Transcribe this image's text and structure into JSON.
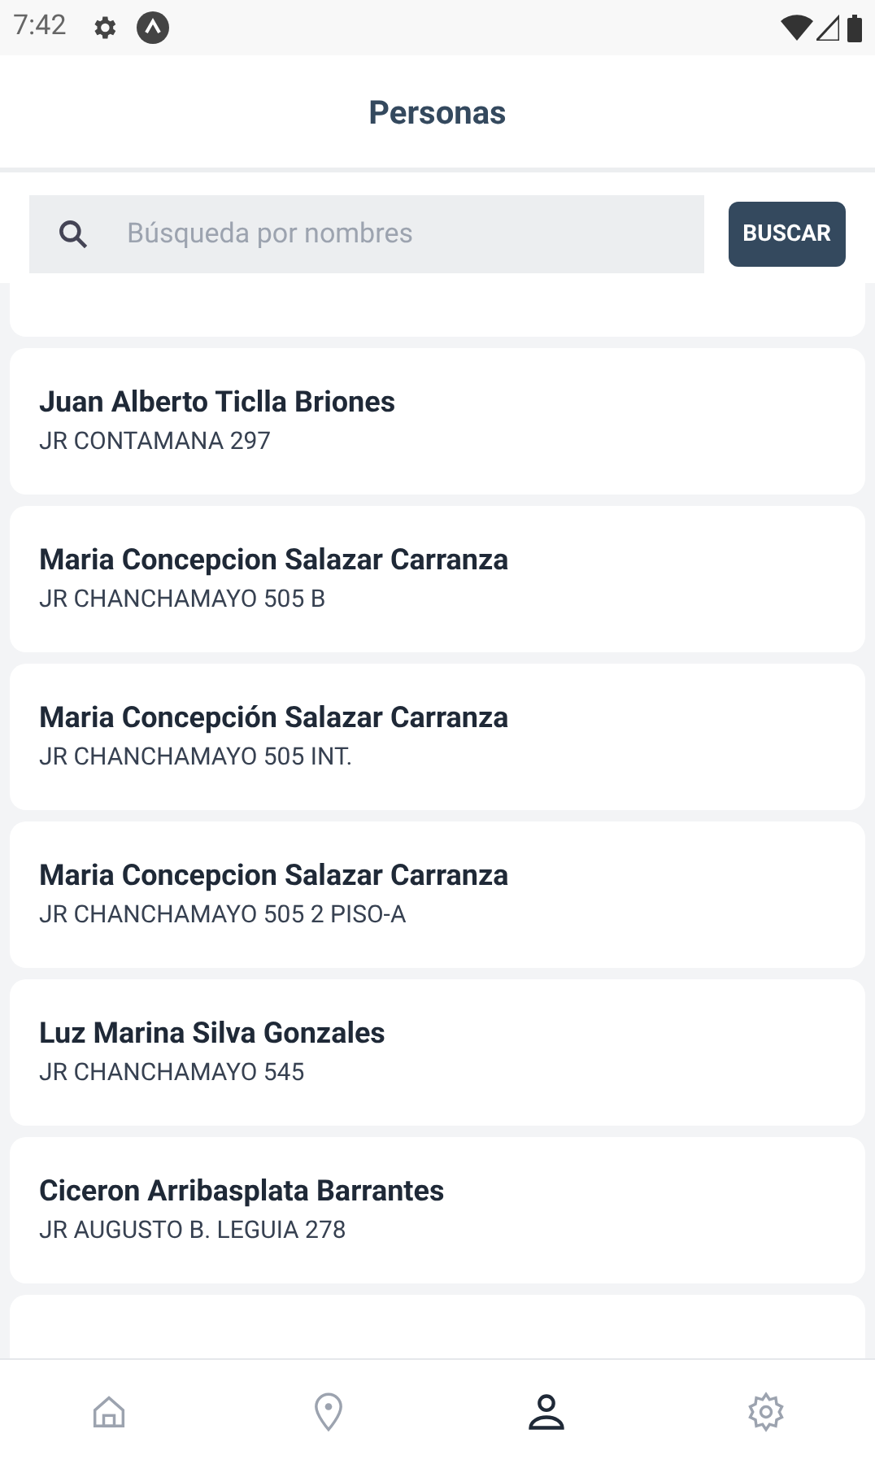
{
  "status_bar": {
    "time": "7:42"
  },
  "header": {
    "title": "Personas"
  },
  "search": {
    "placeholder": "Búsqueda por nombres",
    "button": "BUSCAR"
  },
  "persons": [
    {
      "name": "Juan Alberto Ticlla Briones",
      "address": "JR CONTAMANA 297"
    },
    {
      "name": "Maria Concepcion Salazar Carranza",
      "address": "JR CHANCHAMAYO 505 B"
    },
    {
      "name": "Maria Concepción Salazar Carranza",
      "address": "JR CHANCHAMAYO 505 INT."
    },
    {
      "name": "Maria Concepcion Salazar Carranza",
      "address": "JR CHANCHAMAYO 505 2 PISO-A"
    },
    {
      "name": "Luz Marina Silva Gonzales",
      "address": "JR CHANCHAMAYO 545"
    },
    {
      "name": "Ciceron Arribasplata Barrantes",
      "address": "JR AUGUSTO B. LEGUIA 278"
    }
  ],
  "bottom_nav": [
    {
      "kind": "home",
      "selected": false
    },
    {
      "kind": "location",
      "selected": false
    },
    {
      "kind": "person",
      "selected": true
    },
    {
      "kind": "settings",
      "selected": false
    }
  ]
}
